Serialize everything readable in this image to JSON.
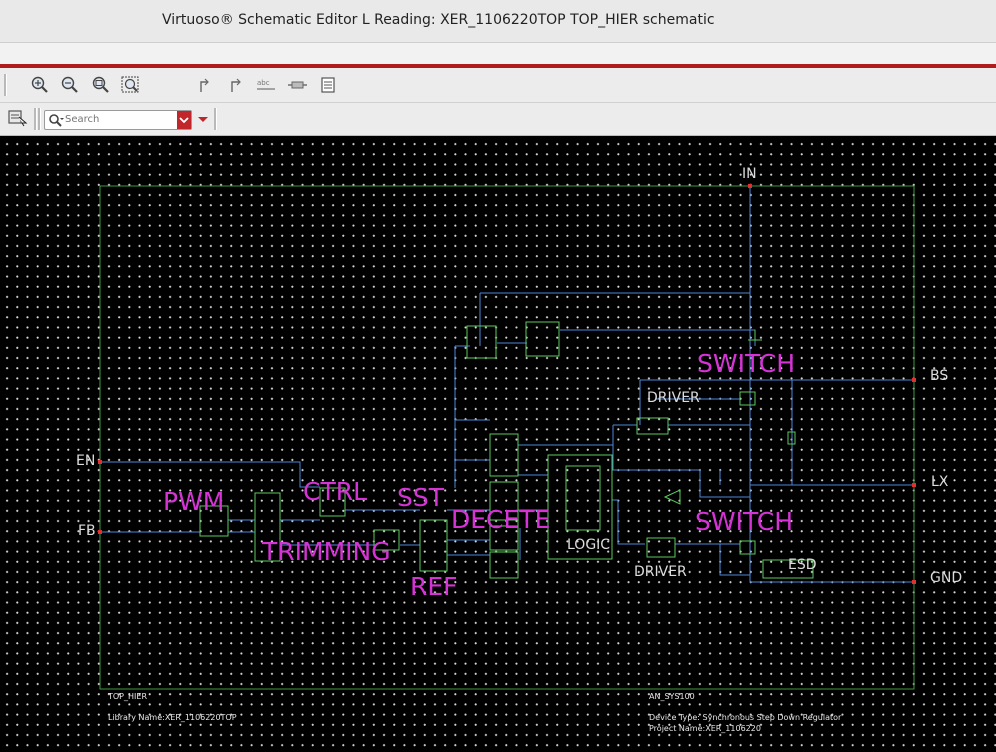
{
  "window": {
    "title": "Virtuoso® Schematic Editor L Reading: XER_1106220TOP TOP_HIER schematic"
  },
  "toolbar": {
    "icons": [
      "zoom-in-icon",
      "zoom-out-icon",
      "zoom-fit-icon",
      "zoom-area-icon",
      "stretch-icon",
      "align-icon",
      "abc-label-icon",
      "pin-icon",
      "property-icon"
    ],
    "search_placeholder": "Search",
    "accent_color": "#c0262a"
  },
  "schematic": {
    "pins": {
      "in": "IN",
      "en": "EN",
      "fb": "FB",
      "bs": "BS",
      "lx": "LX",
      "gnd": "GND"
    },
    "annotations": {
      "pwm": "PWM",
      "ctrl": "CTRL",
      "sst": "SST",
      "trimming": "TRIMMING",
      "ref": "REF",
      "decete": "DECETE",
      "switch_top": "SWITCH",
      "switch_bottom": "SWITCH"
    },
    "instance_labels": {
      "driver_top": "DRIVER",
      "driver_bottom": "DRIVER",
      "logic": "LOGIC",
      "esd": "ESD"
    },
    "title_block": {
      "cell_name": "TOP_HIER",
      "library": "Library Name:XER_1106220TOP",
      "block_id": "AN_SYS100",
      "device_type": "Device Type: Synchronous Step Down Regulator",
      "project": "Project Name:XER_1106220"
    },
    "colors": {
      "wire": "#4d86d6",
      "instance": "#5cc95c",
      "annotation": "#d633d6",
      "pin_marker": "#e03030",
      "background": "#000000"
    }
  }
}
